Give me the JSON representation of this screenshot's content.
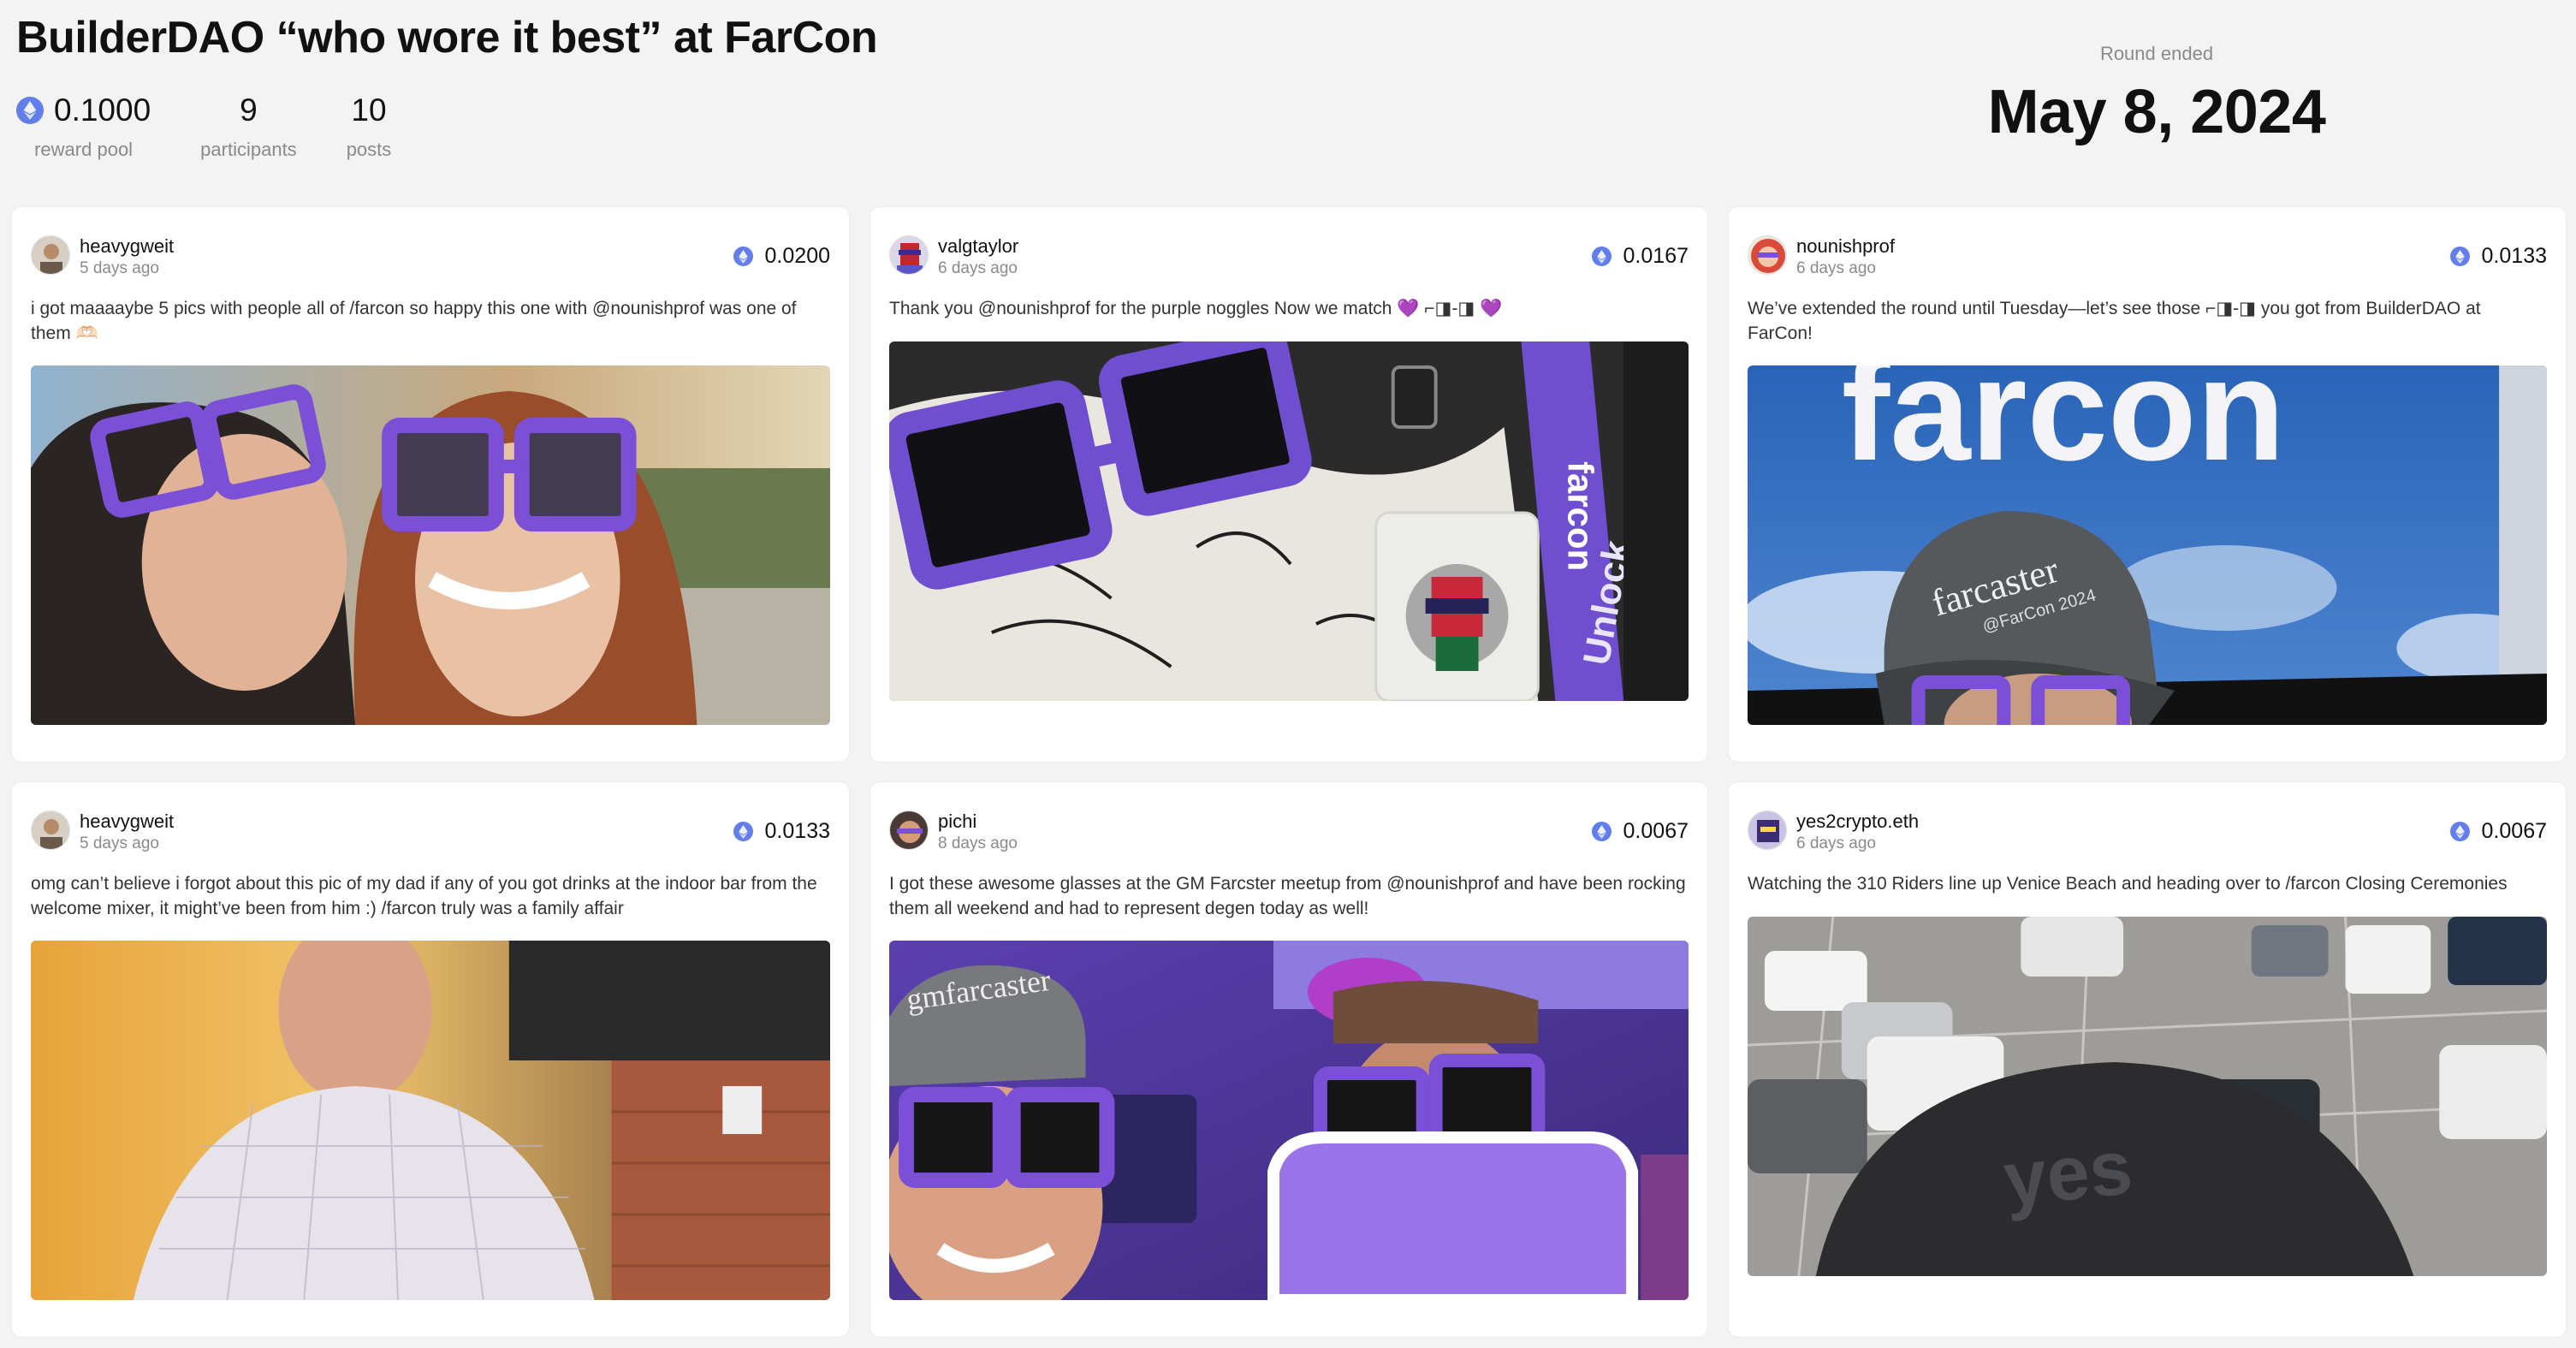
{
  "header": {
    "title": "BuilderDAO “who wore it best” at FarCon",
    "stats": {
      "reward_pool_value": "0.1000",
      "reward_pool_label": "reward pool",
      "participants_value": "9",
      "participants_label": "participants",
      "posts_value": "10",
      "posts_label": "posts"
    },
    "round_label": "Round ended",
    "round_date": "May 8, 2024"
  },
  "posts": [
    {
      "username": "heavygweit",
      "time": "5 days ago",
      "amount": "0.0200",
      "text": "i got maaaaybe 5 pics with people all of /farcon so happy this one with @nounishprof was one of them 🫶🏻",
      "icon": "eth-icon"
    },
    {
      "username": "valgtaylor",
      "time": "6 days ago",
      "amount": "0.0167",
      "text": "Thank you @nounishprof for the purple noggles Now we match 💜 ⌐◨-◨ 💜",
      "icon": "eth-icon"
    },
    {
      "username": "nounishprof",
      "time": "6 days ago",
      "amount": "0.0133",
      "text": "We’ve extended the round until Tuesday—let’s see those ⌐◨-◨ you got from BuilderDAO at FarCon!",
      "icon": "eth-icon"
    },
    {
      "username": "heavygweit",
      "time": "5 days ago",
      "amount": "0.0133",
      "text": "omg can’t believe i forgot about this pic of my dad if any of you got drinks at the indoor bar from the welcome mixer, it might’ve been from him :) /farcon truly was a family affair",
      "icon": "eth-icon"
    },
    {
      "username": "pichi",
      "time": "8 days ago",
      "amount": "0.0067",
      "text": "I got these awesome glasses at the GM Farcster meetup from @nounishprof and have been rocking them all weekend and had to represent degen today as well!",
      "icon": "eth-icon"
    },
    {
      "username": "yes2crypto.eth",
      "time": "6 days ago",
      "amount": "0.0067",
      "text": "Watching the 310 Riders line up Venice Beach and heading over to /farcon Closing Ceremonies",
      "icon": "eth-icon"
    }
  ],
  "photo_text": {
    "lanyard": "farcon",
    "unlock": "Unlock",
    "sign": "farcon",
    "cap": "farcaster",
    "cap_sub": "@FarCon 2024",
    "cap2": "gmfarcaster",
    "yes_cap": "yes"
  },
  "colors": {
    "background": "#f3f3f3",
    "card": "#ffffff",
    "eth": "#627eea",
    "noggles_purple": "#7b4fd6"
  }
}
